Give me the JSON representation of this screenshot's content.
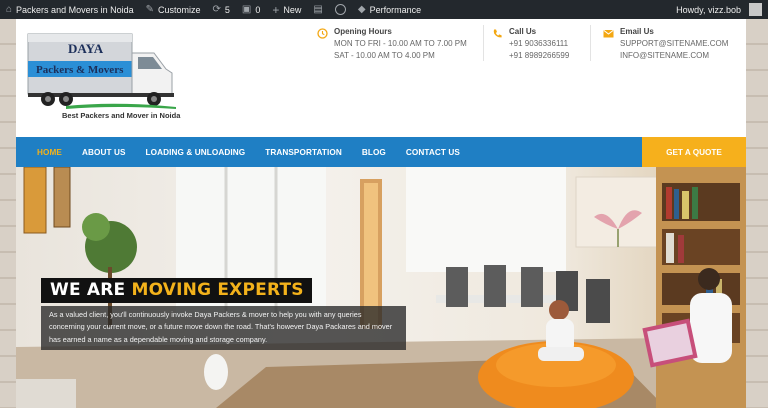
{
  "admin_bar": {
    "site_name": "Packers and Movers in Noida",
    "customize": "Customize",
    "updates_count": "5",
    "comments_count": "0",
    "new_label": "New",
    "performance_label": "Performance",
    "howdy": "Howdy, vizz.bob"
  },
  "header": {
    "logo": {
      "line1": "DAYA",
      "line2": "Packers & Movers",
      "tagline": "Best Packers and Mover in Noida"
    },
    "hours": {
      "title": "Opening Hours",
      "line1": "MON TO FRI - 10.00 AM TO 7.00 PM",
      "line2": "SAT - 10.00 AM TO 4.00 PM"
    },
    "call": {
      "title": "Call Us",
      "line1": "+91 9036336111",
      "line2": "+91 8989266599"
    },
    "email": {
      "title": "Email Us",
      "line1": "SUPPORT@SITENAME.COM",
      "line2": "INFO@SITENAME.COM"
    }
  },
  "nav": {
    "items": [
      "HOME",
      "ABOUT US",
      "LOADING & UNLOADING",
      "TRANSPORTATION",
      "BLOG",
      "CONTACT US"
    ],
    "active_index": 0,
    "quote_label": "GET A QUOTE"
  },
  "hero": {
    "heading_white": "WE ARE ",
    "heading_orange": "MOVING EXPERTS",
    "text": "As a valued client, you'll continuously invoke Daya Packers & mover to help you with any queries concerning your current move, or a future move down the road. That's however Daya Packares and mover has earned a name as a dependable moving and storage company."
  },
  "colors": {
    "admin_bar": "#23282d",
    "nav_blue": "#1f7fc4",
    "accent_orange": "#f6b01c"
  },
  "icons": {
    "hours": "clock-icon",
    "call": "phone-icon",
    "email": "envelope-icon"
  }
}
